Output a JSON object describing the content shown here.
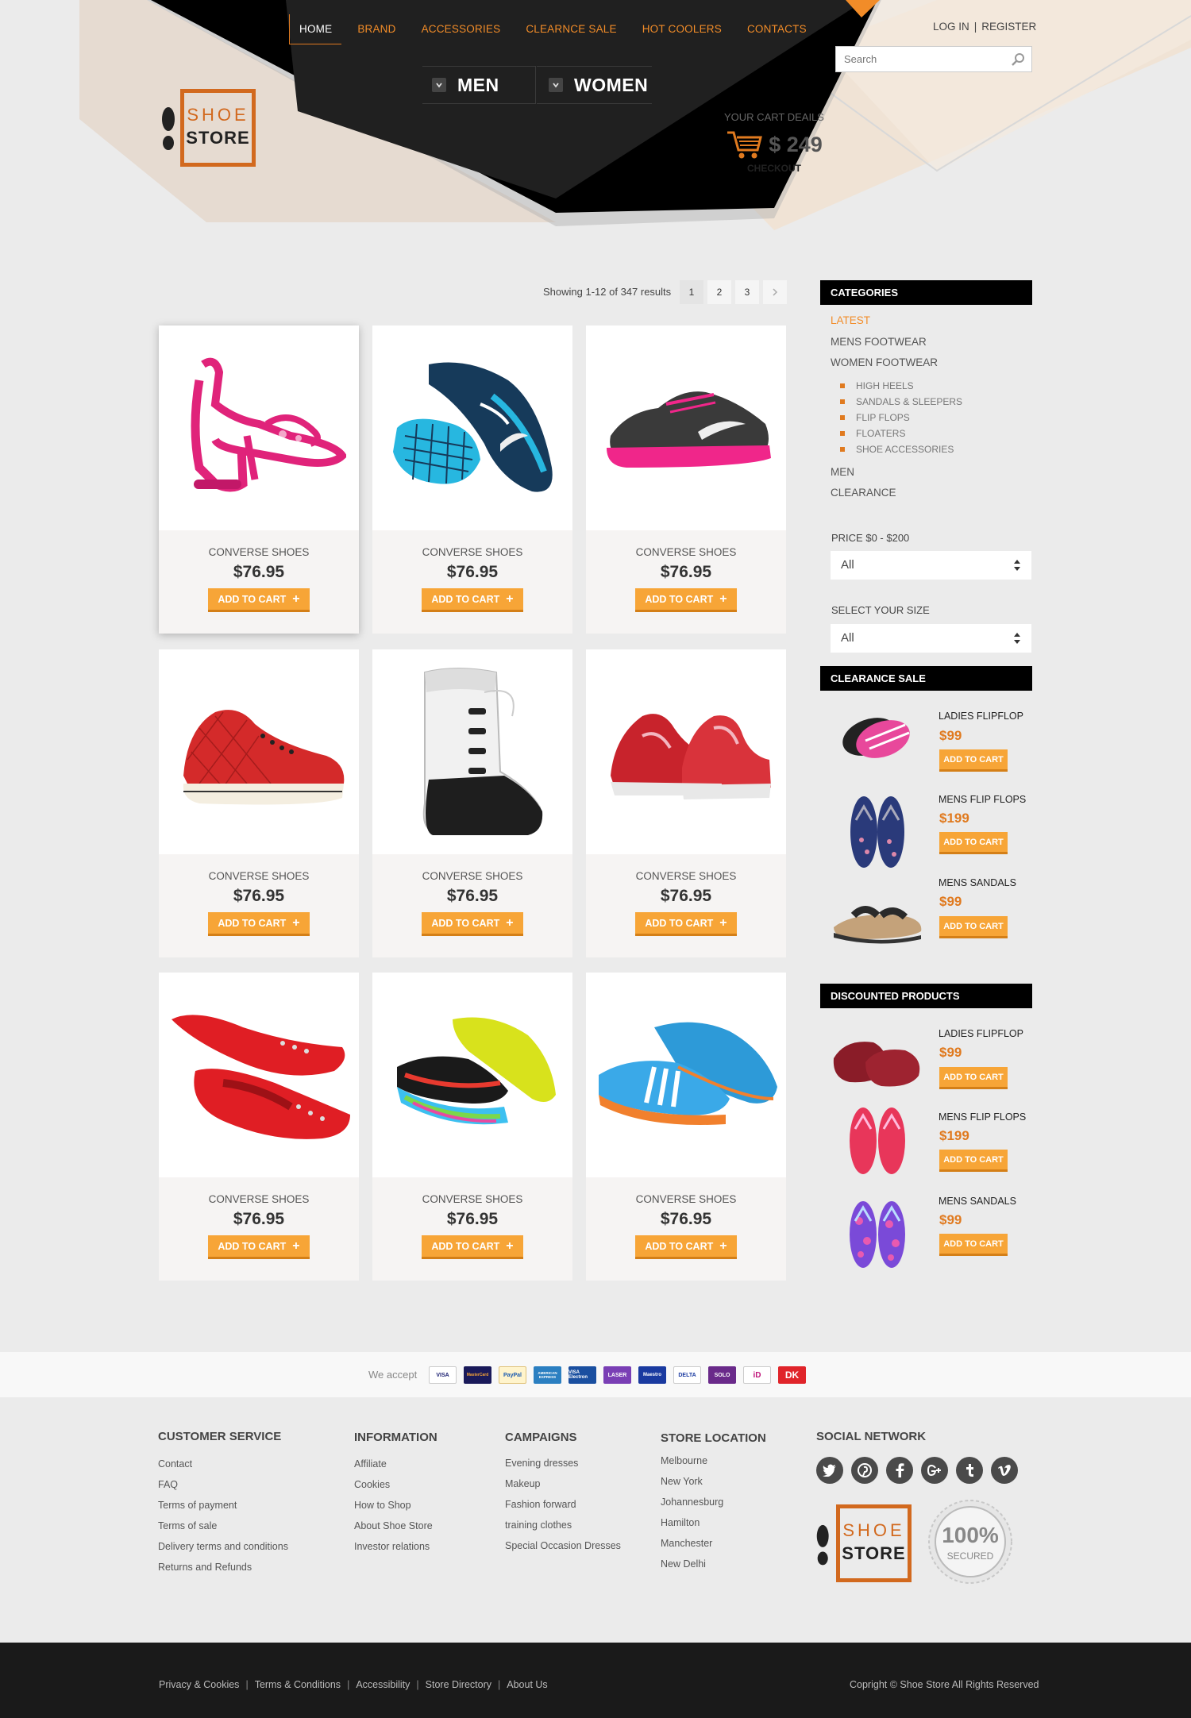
{
  "nav": {
    "items": [
      "HOME",
      "BRAND",
      "ACCESSORIES",
      "CLEARNCE SALE",
      "HOT COOLERS",
      "CONTACTS"
    ],
    "active": "HOME"
  },
  "auth": {
    "login": "LOG IN",
    "separator": "|",
    "register": "REGISTER"
  },
  "search": {
    "placeholder": "Search"
  },
  "gender_tabs": [
    "MEN",
    "WOMEN"
  ],
  "logo": {
    "line1": "SHOE",
    "line2": "STORE"
  },
  "cart": {
    "title": "YOUR CART DEAILS",
    "total": "$ 249",
    "checkout": "CHECKOUT"
  },
  "listing": {
    "results_text": "Showing 1-12 of 347 results",
    "pages": [
      "1",
      "2",
      "3"
    ],
    "next_icon": "chevron-right-icon"
  },
  "products": [
    {
      "name": "CONVERSE SHOES",
      "price": "$76.95",
      "button": "ADD TO CART",
      "image": "pink-heeled-sandal"
    },
    {
      "name": "CONVERSE SHOES",
      "price": "$76.95",
      "button": "ADD TO CART",
      "image": "blue-running-shoe"
    },
    {
      "name": "CONVERSE SHOES",
      "price": "$76.95",
      "button": "ADD TO CART",
      "image": "black-pink-sneaker"
    },
    {
      "name": "CONVERSE SHOES",
      "price": "$76.95",
      "button": "ADD TO CART",
      "image": "red-quilted-sneaker"
    },
    {
      "name": "CONVERSE SHOES",
      "price": "$76.95",
      "button": "ADD TO CART",
      "image": "white-snow-boot"
    },
    {
      "name": "CONVERSE SHOES",
      "price": "$76.95",
      "button": "ADD TO CART",
      "image": "red-basketball-shoe"
    },
    {
      "name": "CONVERSE SHOES",
      "price": "$76.95",
      "button": "ADD TO CART",
      "image": "red-studded-flat"
    },
    {
      "name": "CONVERSE SHOES",
      "price": "$76.95",
      "button": "ADD TO CART",
      "image": "neon-football-boot"
    },
    {
      "name": "CONVERSE SHOES",
      "price": "$76.95",
      "button": "ADD TO CART",
      "image": "blue-turf-shoe"
    }
  ],
  "sidebar": {
    "categories_title": "CATEGORIES",
    "categories": [
      "LATEST",
      "MENS FOOTWEAR",
      "WOMEN FOOTWEAR"
    ],
    "subcategories": [
      "HIGH HEELS",
      "SANDALS & SLEEPERS",
      "FLIP FLOPS",
      "FLOATERS",
      "SHOE ACCESSORIES"
    ],
    "more_categories": [
      "MEN",
      "CLEARANCE"
    ],
    "price_label": "PRICE $0 - $200",
    "price_value": "All",
    "size_label": "SELECT YOUR SIZE",
    "size_value": "All",
    "clearance_title": "CLEARANCE  SALE",
    "clearance": [
      {
        "name": "LADIES FLIPFLOP",
        "price": "$99",
        "button": "ADD TO CART"
      },
      {
        "name": "MENS FLIP FLOPS",
        "price": "$199",
        "button": "ADD TO CART"
      },
      {
        "name": "MENS SANDALS",
        "price": "$99",
        "button": "ADD TO CART"
      }
    ],
    "discounted_title": "DISCOUNTED PRODUCTS",
    "discounted": [
      {
        "name": "LADIES FLIPFLOP",
        "price": "$99",
        "button": "ADD TO CART"
      },
      {
        "name": "MENS FLIP FLOPS",
        "price": "$199",
        "button": "ADD TO CART"
      },
      {
        "name": "MENS SANDALS",
        "price": "$99",
        "button": "ADD TO CART"
      }
    ]
  },
  "payment": {
    "label": "We accept",
    "cards": [
      "VISA",
      "MasterCard",
      "PayPal",
      "AMERICAN EXPRESS",
      "VISA Electron",
      "LASER",
      "Maestro",
      "DELTA",
      "SOLO",
      "iD",
      "DK"
    ]
  },
  "footer": {
    "customer_service": {
      "title": "CUSTOMER SERVICE",
      "links": [
        "Contact",
        "FAQ",
        "Terms of payment",
        "Terms of sale",
        "Delivery terms and conditions",
        "Returns and Refunds"
      ]
    },
    "information": {
      "title": "INFORMATION",
      "links": [
        "Affiliate",
        "Cookies",
        "How to Shop",
        "About Shoe Store",
        "Investor relations"
      ]
    },
    "campaigns": {
      "title": "CAMPAIGNS",
      "links": [
        "Evening dresses",
        "Makeup",
        "Fashion forward",
        "training clothes",
        "Special Occasion Dresses"
      ]
    },
    "store_location": {
      "title": "STORE LOCATION",
      "links": [
        "Melbourne",
        "New York",
        "Johannesburg",
        "Hamilton",
        "Manchester",
        "New Delhi"
      ]
    },
    "social": {
      "title": "SOCIAL NETWORK",
      "icons": [
        "twitter-icon",
        "pinterest-icon",
        "facebook-icon",
        "google-plus-icon",
        "tumblr-icon",
        "vimeo-icon"
      ]
    },
    "badge": {
      "line1": "100%",
      "line2": "SECURED"
    }
  },
  "bottom": {
    "links": [
      "Privacy & Cookies",
      "Terms & Conditions",
      "Accessibility",
      "Store Directory",
      "About Us"
    ],
    "separator": "|",
    "copyright": "Copright © Shoe Store  All Rights Reserved"
  },
  "colors": {
    "accent": "#f28c28",
    "button": "#f7a537",
    "dark": "#1a1a1a"
  }
}
